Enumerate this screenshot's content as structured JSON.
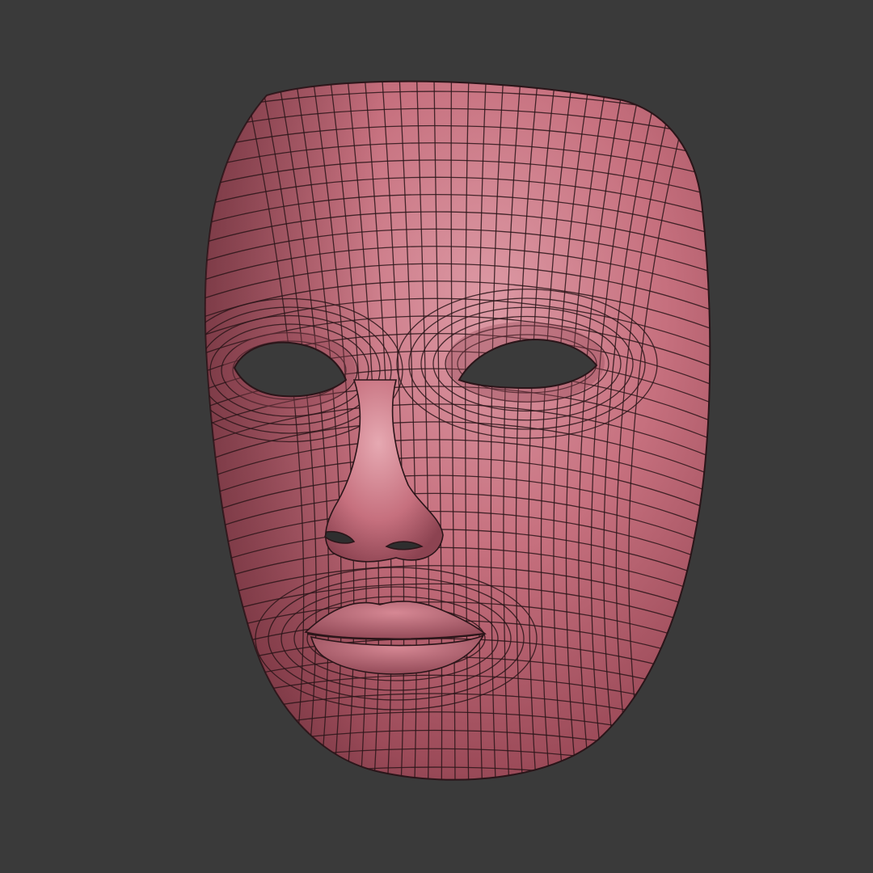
{
  "scene": {
    "background_color": "#3a3a3a",
    "model": {
      "subject": "face-mask",
      "shading": "clay",
      "wireframe_overlay": true,
      "colors": {
        "skin_base": "#c6707e",
        "skin_highlight": "#dd9aa5",
        "skin_shadow": "#7e3b48",
        "wire": "#2a1519",
        "hole": "#3a3a3a"
      }
    }
  }
}
